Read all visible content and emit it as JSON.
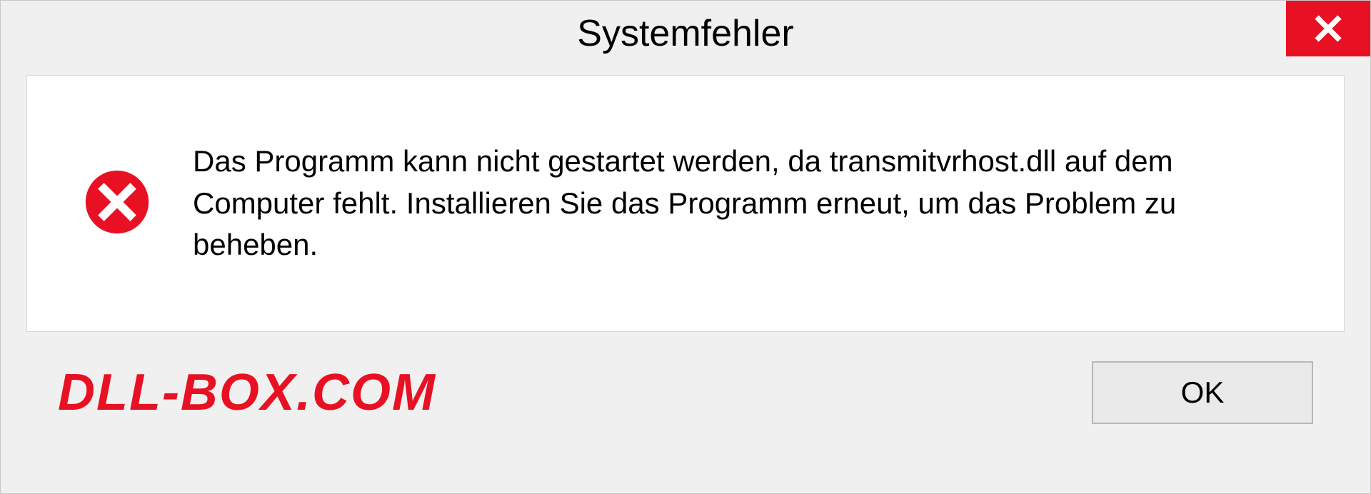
{
  "dialog": {
    "title": "Systemfehler",
    "message": "Das Programm kann nicht gestartet werden, da transmitvrhost.dll auf dem Computer fehlt. Installieren Sie das Programm erneut, um das Problem zu beheben.",
    "ok_label": "OK"
  },
  "watermark": "DLL-BOX.COM"
}
